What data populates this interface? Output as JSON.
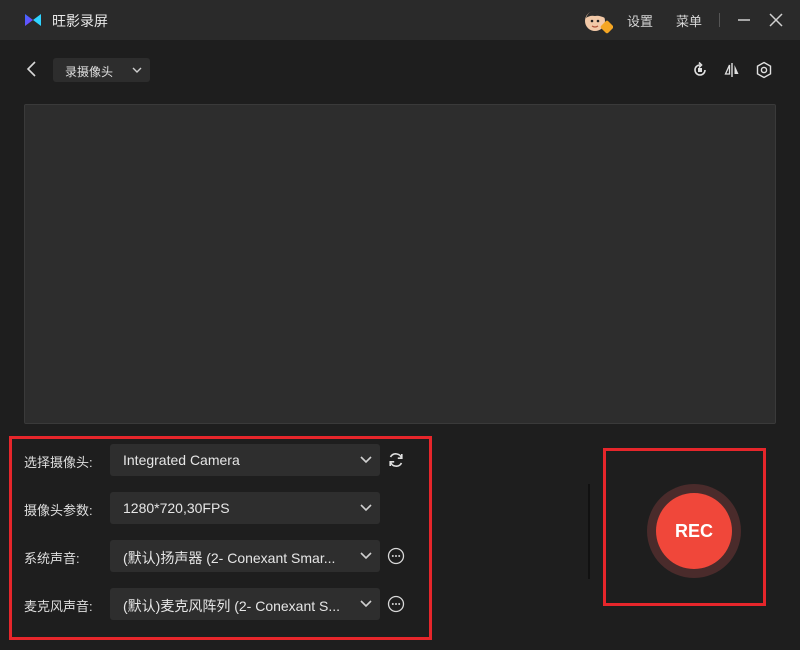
{
  "titlebar": {
    "app_title": "旺影录屏",
    "settings_label": "设置",
    "menu_label": "菜单",
    "logo_icon": "app-logo-icon",
    "minimize_icon": "minimize-icon",
    "close_icon": "close-icon"
  },
  "toolbar": {
    "mode": "录摄像头",
    "back_icon": "chevron-left-icon",
    "rotate_icon": "rotate-icon",
    "mirror_icon": "mirror-flip-icon",
    "settings_icon": "hexagon-settings-icon"
  },
  "settings": {
    "rows": [
      {
        "label": "选择摄像头:",
        "value": "Integrated Camera",
        "action_icon": "refresh-icon"
      },
      {
        "label": "摄像头参数:",
        "value": "1280*720,30FPS"
      },
      {
        "label": "系统声音:",
        "value": "(默认)扬声器 (2- Conexant Smar...",
        "action_icon": "more-options-icon"
      },
      {
        "label": "麦克风声音:",
        "value": "(默认)麦克风阵列 (2- Conexant S...",
        "action_icon": "more-options-icon"
      }
    ]
  },
  "record": {
    "label": "REC"
  },
  "colors": {
    "background": "#1e1e1e",
    "titlebar": "#2a2a2a",
    "preview": "#2d2d2d",
    "accent_red": "#f0473a",
    "highlight_border": "#e6262b"
  }
}
